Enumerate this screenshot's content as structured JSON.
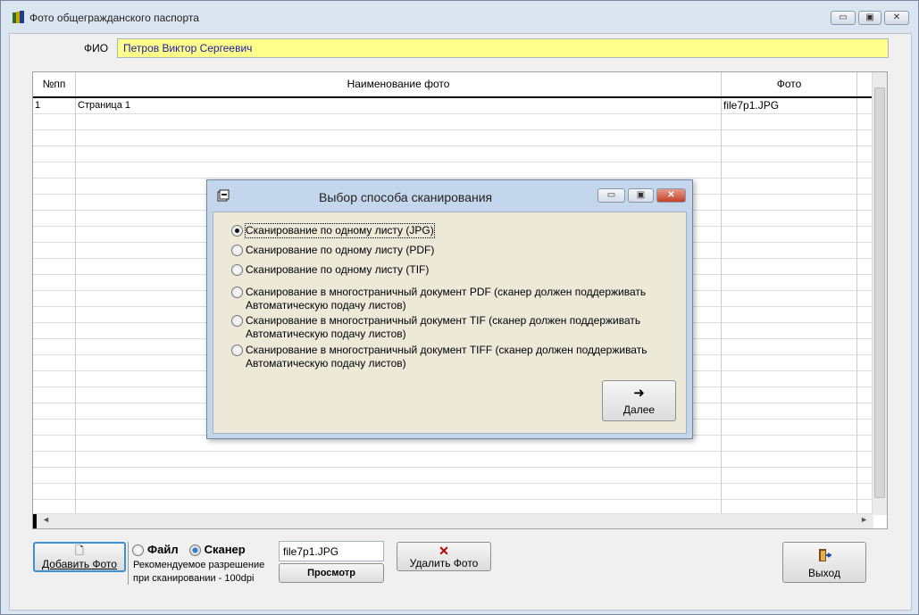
{
  "window": {
    "title": "Фото общегражданского паспорта",
    "min": "▭",
    "max": "▣",
    "close": "✕"
  },
  "fio": {
    "label": "ФИО",
    "value": "Петров Виктор Сергеевич"
  },
  "table": {
    "columns": [
      "№пп",
      "Наименование фото",
      "Фото"
    ],
    "rows": [
      {
        "num": "1",
        "name": "Страница 1",
        "photo": "file7p1.JPG"
      }
    ]
  },
  "dialog": {
    "title": "Выбор способа сканирования",
    "options": [
      "Сканирование по одному листу (JPG)",
      "Сканирование по одному листу (PDF)",
      "Сканирование по одному листу (TIF)",
      "Сканирование в многостраничный документ PDF (сканер должен поддерживать Автоматическую подачу листов)",
      "Сканирование в многостраничный документ TIF (сканер должен поддерживать Автоматическую подачу листов)",
      "Сканирование в многостраничный документ TIFF (сканер должен поддерживать Автоматическую подачу листов)"
    ],
    "selected": 0,
    "next_label": "Далее",
    "next_icon": "➜"
  },
  "bottom": {
    "add_label": "Добавить Фото",
    "source_file": "Файл",
    "source_scanner": "Сканер",
    "hint1": "Рекомендуемое разрешение",
    "hint2": "при сканировании - 100dpi",
    "filename": "file7p1.JPG",
    "view_label": "Просмотр",
    "delete_label": "Удалить Фото",
    "delete_icon": "✕",
    "exit_label": "Выход"
  }
}
